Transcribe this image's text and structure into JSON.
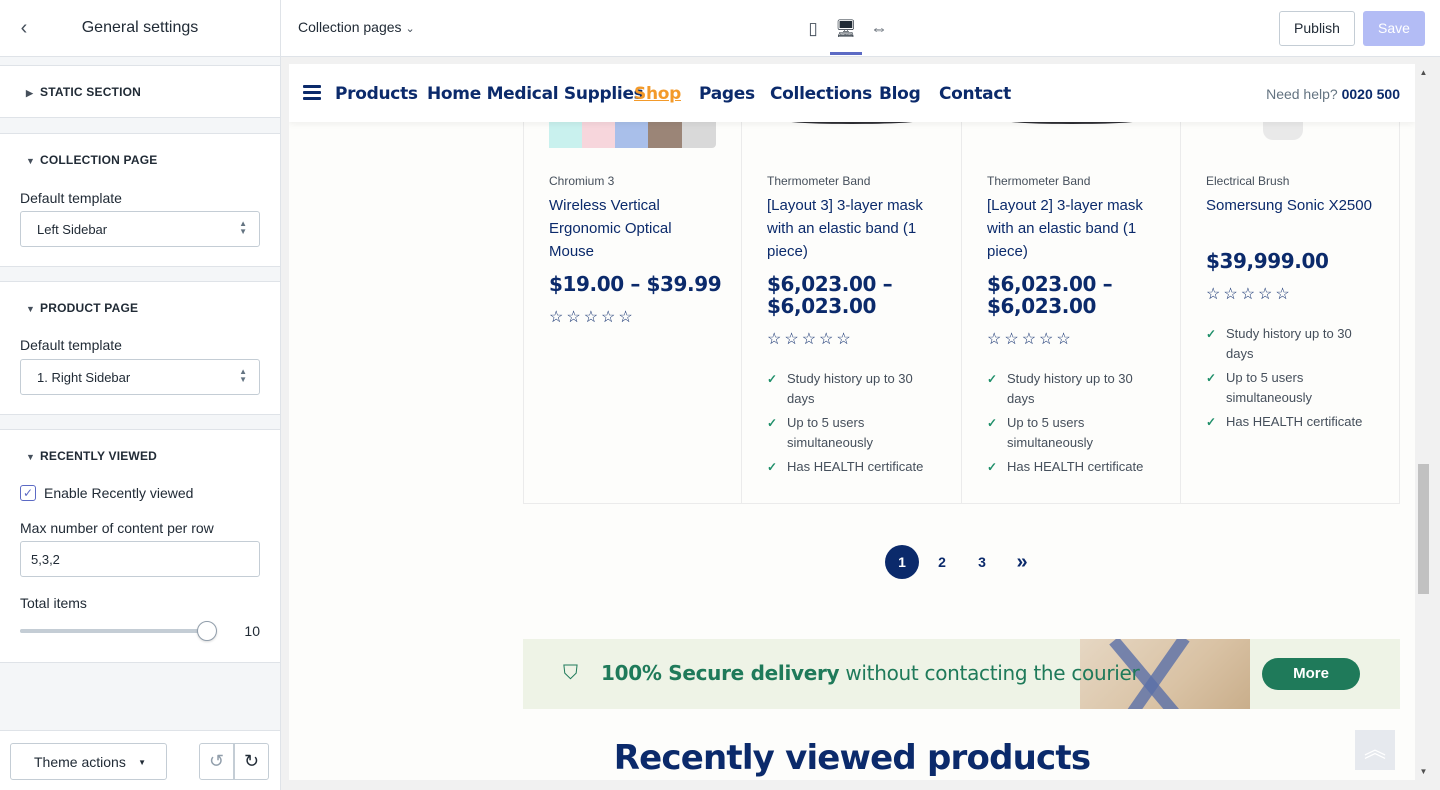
{
  "sidebar": {
    "title": "General settings",
    "sections": {
      "static": {
        "label": "STATIC SECTION"
      },
      "collection": {
        "label": "COLLECTION PAGE",
        "field_label": "Default template",
        "value": "Left Sidebar"
      },
      "product": {
        "label": "PRODUCT PAGE",
        "field_label": "Default template",
        "value": "1. Right Sidebar"
      },
      "recent": {
        "label": "RECENTLY VIEWED",
        "enable_label": "Enable Recently viewed",
        "enabled": true,
        "max_label": "Max number of content per row",
        "max_value": "5,3,2",
        "total_label": "Total items",
        "total_value": "10"
      }
    },
    "footer": {
      "theme_actions": "Theme actions"
    }
  },
  "topbar": {
    "page_select": "Collection pages",
    "devices": [
      "mobile-icon",
      "desktop-icon",
      "fullwidth-icon"
    ],
    "active_device": "desktop",
    "publish": "Publish",
    "save": "Save"
  },
  "site": {
    "nav": [
      "Products",
      "Home Medical Supplies",
      "Shop",
      "Pages",
      "Collections",
      "Blog",
      "Contact"
    ],
    "active_nav": "Shop",
    "help_label": "Need help?",
    "help_phone": "0020 500",
    "products": [
      {
        "category": "Chromium 3",
        "name": "Wireless Vertical Ergonomic Optical Mouse",
        "price": "$19.00 – $39.99",
        "rating": "☆☆☆☆☆",
        "features": []
      },
      {
        "category": "Thermometer Band",
        "name": "[Layout 3] 3-layer mask with an elastic band (1 piece)",
        "price": "$6,023.00 – $6,023.00",
        "rating": "☆☆☆☆☆",
        "features": [
          "Study history up to 30 days",
          "Up to 5 users simultaneously",
          "Has HEALTH certificate"
        ]
      },
      {
        "category": "Thermometer Band",
        "name": "[Layout 2] 3-layer mask with an elastic band (1 piece)",
        "price": "$6,023.00 – $6,023.00",
        "rating": "☆☆☆☆☆",
        "features": [
          "Study history up to 30 days",
          "Up to 5 users simultaneously",
          "Has HEALTH certificate"
        ]
      },
      {
        "category": "Electrical Brush",
        "name": "Somersung Sonic X2500",
        "price": "$39,999.00",
        "rating": "☆☆☆☆☆",
        "features": [
          "Study history up to 30 days",
          "Up to 5 users simultaneously",
          "Has HEALTH certificate"
        ]
      }
    ],
    "pagination": [
      "1",
      "2",
      "3",
      "»"
    ],
    "current_page": "1",
    "banner": {
      "bold": "100% Secure delivery",
      "rest": " without contacting the courier",
      "button": "More"
    },
    "recently_viewed_title": "Recently viewed products",
    "swatch_colors": [
      "#c9f1ee",
      "#f7d6dc",
      "#a9bfea",
      "#9b8577",
      "#d9d9d9"
    ],
    "accent": "#0b2a6b",
    "highlight": "#f39a2a"
  }
}
